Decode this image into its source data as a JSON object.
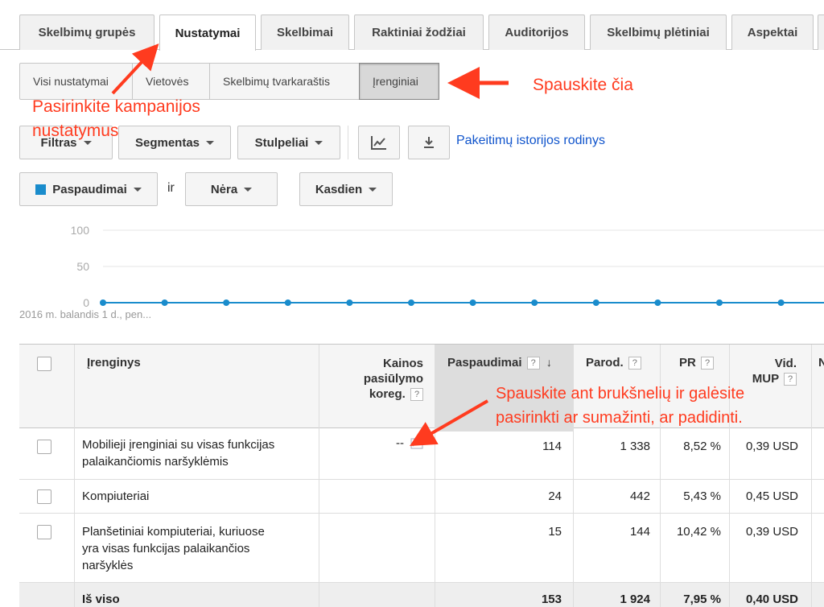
{
  "tabs": [
    "Skelbimų grupės",
    "Nustatymai",
    "Skelbimai",
    "Raktiniai žodžiai",
    "Auditorijos",
    "Skelbimų plėtiniai",
    "Aspektai"
  ],
  "subtabs": [
    "Visi nustatymai",
    "Vietovės",
    "Skelbimų tvarkaraštis",
    "Įrenginiai"
  ],
  "toolbar": {
    "filter": "Filtras",
    "segment": "Segmentas",
    "columns": "Stulpeliai",
    "chart_icon": "line-chart-icon",
    "download_icon": "download-icon",
    "history_link": "Pakeitimų istorijos rodinys"
  },
  "metrics": {
    "metric1": "Paspaudimai",
    "and": "ir",
    "metric2": "Nėra",
    "period": "Kasdien",
    "metric_color": "#1a8ccc"
  },
  "chart_data": {
    "type": "line",
    "yticks": [
      "100",
      "50",
      "0"
    ],
    "ylim": [
      0,
      100
    ],
    "x_label_first": "2016 m. balandis 1 d., pen...",
    "series": [
      {
        "values": [
          0,
          0,
          0,
          0,
          0,
          0,
          0,
          0,
          0,
          0,
          0,
          0,
          0,
          0
        ]
      }
    ],
    "color": "#1a8ccc",
    "grid": true
  },
  "table": {
    "headers": {
      "device": "Įrenginys",
      "bid1": "Kainos",
      "bid2": "pasiūlymo",
      "bid3": "koreg.",
      "clicks": "Paspaudimai",
      "impr": "Parod.",
      "ctr": "PR",
      "cpc1": "Vid.",
      "cpc2": "MUP",
      "help": "?"
    },
    "rows": [
      {
        "device1": "Mobilieji įrenginiai su visas funkcijas",
        "device2": "palaikančiomis naršyklėmis",
        "device3": "",
        "bid": "--",
        "clicks": "114",
        "impr": "1 338",
        "ctr": "8,52 %",
        "cpc": "0,39 USD"
      },
      {
        "device1": "Kompiuteriai",
        "device2": "",
        "device3": "",
        "bid": "",
        "clicks": "24",
        "impr": "442",
        "ctr": "5,43 %",
        "cpc": "0,45 USD"
      },
      {
        "device1": "Planšetiniai kompiuteriai, kuriuose",
        "device2": "yra visas funkcijas palaikančios",
        "device3": "naršyklės",
        "bid": "",
        "clicks": "15",
        "impr": "144",
        "ctr": "10,42 %",
        "cpc": "0,39 USD"
      }
    ],
    "total": {
      "label": "Iš viso",
      "clicks": "153",
      "impr": "1 924",
      "ctr": "7,95 %",
      "cpc": "0,40 USD"
    }
  },
  "annotations": {
    "campaign1": "Pasirinkite kampanijos",
    "campaign2": "nustatymus",
    "click_here": "Spauskite čia",
    "dashes1": "Spauskite ant brukšnelių ir galėsite",
    "dashes2": "pasirinkti ar sumažinti, ar padidinti.",
    "color": "#ff3b1f"
  }
}
